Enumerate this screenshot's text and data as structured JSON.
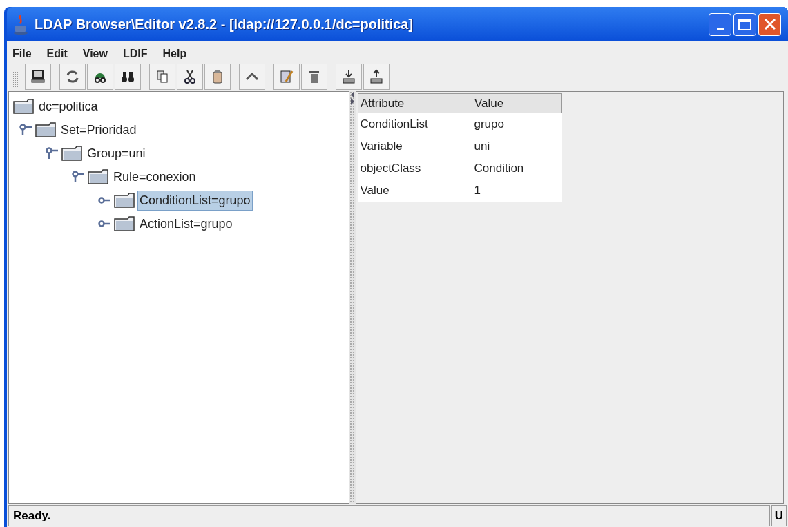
{
  "window": {
    "title": "LDAP Browser\\Editor v2.8.2 - [ldap://127.0.0.1/dc=politica]"
  },
  "menu": [
    "File",
    "Edit",
    "View",
    "LDIF",
    "Help"
  ],
  "tree": [
    {
      "label": "dc=politica",
      "selected": false,
      "children": [
        {
          "label": "Set=Prioridad",
          "expanded": true,
          "selected": false,
          "children": [
            {
              "label": "Group=uni",
              "expanded": true,
              "selected": false,
              "children": [
                {
                  "label": "Rule=conexion",
                  "expanded": true,
                  "selected": false,
                  "children": [
                    {
                      "label": "ConditionList=grupo",
                      "expanded": false,
                      "selected": true
                    },
                    {
                      "label": "ActionList=grupo",
                      "expanded": false,
                      "selected": false
                    }
                  ]
                }
              ]
            }
          ]
        }
      ]
    }
  ],
  "table": {
    "columns": [
      "Attribute",
      "Value"
    ],
    "rows": [
      [
        "ConditionList",
        "grupo"
      ],
      [
        "Variable",
        "uni"
      ],
      [
        "objectClass",
        "Condition"
      ],
      [
        "Value",
        "1"
      ]
    ]
  },
  "status_bar": {
    "message": "Ready.",
    "indicator": "U"
  }
}
